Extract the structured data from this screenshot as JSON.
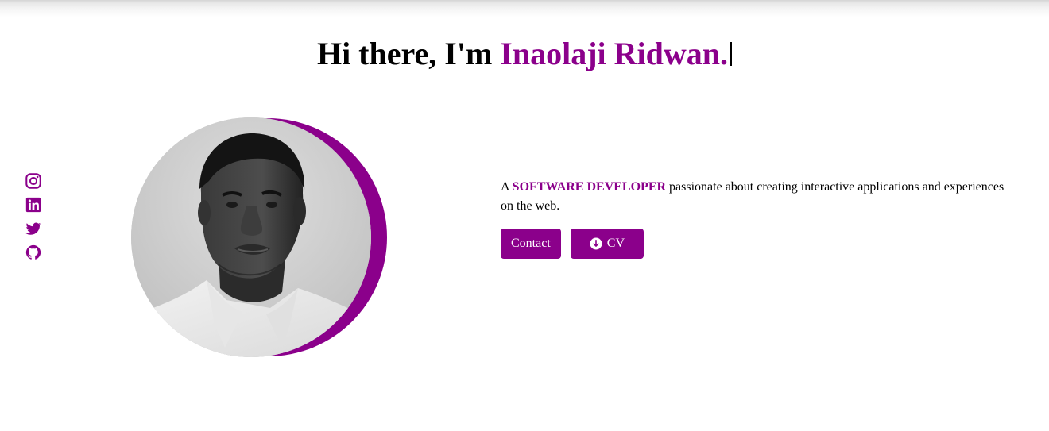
{
  "header": {
    "greeting": "Hi there, I'm",
    "name": "Inaolaji Ridwan."
  },
  "socials": [
    {
      "icon": "instagram-icon"
    },
    {
      "icon": "linkedin-icon"
    },
    {
      "icon": "twitter-icon"
    },
    {
      "icon": "github-icon"
    }
  ],
  "intro": {
    "prefix": "A",
    "role": "SOFTWARE DEVELOPER",
    "description": "passionate about creating interactive applications and experiences on the web."
  },
  "buttons": {
    "contact_label": "Contact",
    "cv_label": "CV",
    "cv_icon": "download-circle-icon"
  },
  "colors": {
    "accent": "#8b008b",
    "text": "#000000",
    "background": "#ffffff"
  }
}
